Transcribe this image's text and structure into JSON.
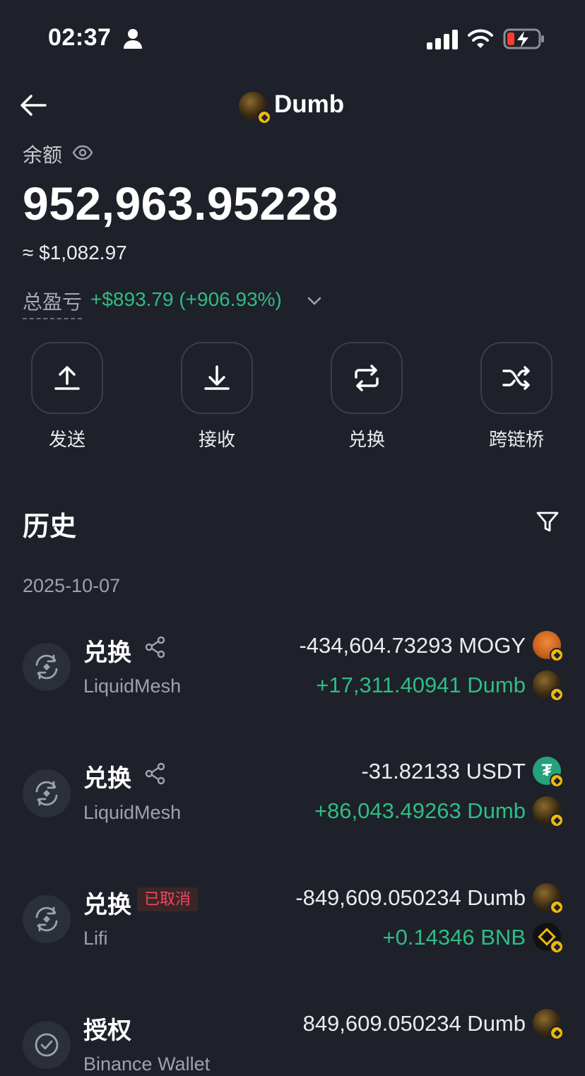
{
  "status_bar": {
    "time": "02:37"
  },
  "header": {
    "title": "Dumb",
    "back_icon": "arrow-left-icon",
    "token_icon": "dumb-token-icon"
  },
  "balance": {
    "label": "余额",
    "amount": "952,963.95228",
    "usd": "≈ $1,082.97",
    "pnl_label": "总盈亏",
    "pnl_value": "+$893.79 (+906.93%)"
  },
  "actions": [
    {
      "label": "发送",
      "icon": "send-arrow-up-icon"
    },
    {
      "label": "接收",
      "icon": "receive-arrow-down-icon"
    },
    {
      "label": "兑换",
      "icon": "swap-icon"
    },
    {
      "label": "跨链桥",
      "icon": "bridge-shuffle-icon"
    }
  ],
  "history": {
    "title": "历史",
    "date": "2025-10-07",
    "items": [
      {
        "type": "兑换",
        "sub": "LiquidMesh",
        "tag": "",
        "line1": "-434,604.73293 MOGY",
        "line2": "+17,311.40941 Dumb"
      },
      {
        "type": "兑换",
        "sub": "LiquidMesh",
        "tag": "",
        "line1": "-31.82133 USDT",
        "line2": "+86,043.49263 Dumb"
      },
      {
        "type": "兑换",
        "sub": "Lifi",
        "tag": "已取消",
        "line1": "-849,609.050234 Dumb",
        "line2": "+0.14346 BNB"
      },
      {
        "type": "授权",
        "sub": "Binance Wallet",
        "tag": "",
        "line1": "849,609.050234 Dumb",
        "line2": ""
      }
    ]
  },
  "colors": {
    "background": "#1e2129",
    "positive": "#2ebd85",
    "negative_tag": "#f6465d",
    "bnb": "#f0b90b"
  }
}
